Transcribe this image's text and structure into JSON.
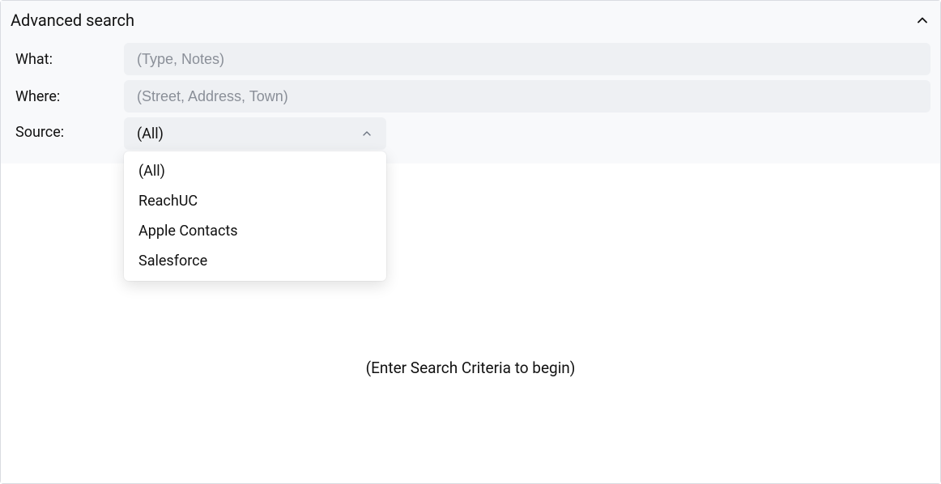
{
  "header": {
    "title": "Advanced search"
  },
  "fields": {
    "what": {
      "label": "What:",
      "placeholder": "(Type, Notes)",
      "value": ""
    },
    "where": {
      "label": "Where:",
      "placeholder": "(Street, Address, Town)",
      "value": ""
    },
    "source": {
      "label": "Source:",
      "selected": "(All)",
      "options": [
        "(All)",
        "ReachUC",
        "Apple Contacts",
        "Salesforce"
      ]
    }
  },
  "results": {
    "placeholder": "(Enter Search Criteria to begin)"
  }
}
